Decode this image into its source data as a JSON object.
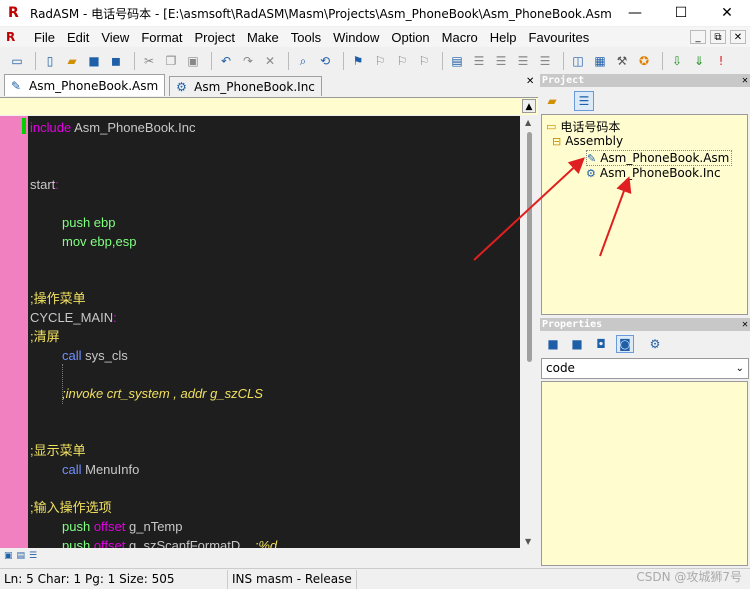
{
  "window": {
    "title": "RadASM - 电话号码本 - [E:\\asmsoft\\RadASM\\Masm\\Projects\\Asm_PhoneBook\\Asm_PhoneBook.Asm]",
    "minimize": "—",
    "maximize": "☐",
    "close": "✕"
  },
  "menu": {
    "items": [
      "File",
      "Edit",
      "View",
      "Format",
      "Project",
      "Make",
      "Tools",
      "Window",
      "Option",
      "Macro",
      "Help",
      "Favourites"
    ],
    "right_buttons": [
      "_",
      "⧉",
      "✕"
    ]
  },
  "toolbar": {
    "icons": [
      "print-icon",
      "new-file-icon",
      "open-icon",
      "save-icon",
      "save-all-icon",
      "cut-icon",
      "copy-icon",
      "paste-icon",
      "undo-icon",
      "redo-icon",
      "delete-icon",
      "find-icon",
      "replace-icon",
      "bookmark-icon",
      "next-bookmark-icon",
      "prev-bookmark-icon",
      "clear-bookmark-icon",
      "block-icon",
      "indent-icon",
      "outdent-icon",
      "comment-icon",
      "uncomment-icon",
      "view-output-icon",
      "view-project-icon",
      "tools-icon",
      "star-icon",
      "build-icon",
      "go-icon",
      "error-icon"
    ]
  },
  "tabs": [
    {
      "label": "Asm_PhoneBook.Asm",
      "active": true
    },
    {
      "label": "Asm_PhoneBook.Inc",
      "active": false
    }
  ],
  "editor": {
    "lines": [
      {
        "indent": 0,
        "parts": [
          {
            "t": "include ",
            "c": "kw"
          },
          {
            "t": "Asm_PhoneBook.Inc",
            "c": "lbl"
          }
        ]
      },
      {
        "indent": 0,
        "parts": []
      },
      {
        "indent": 0,
        "parts": []
      },
      {
        "indent": 0,
        "parts": [
          {
            "t": "start",
            "c": "lbl"
          },
          {
            "t": ":",
            "c": "kw"
          }
        ]
      },
      {
        "indent": 0,
        "parts": []
      },
      {
        "indent": 1,
        "parts": [
          {
            "t": "push ebp",
            "c": "ins"
          }
        ]
      },
      {
        "indent": 1,
        "parts": [
          {
            "t": "mov ebp,esp",
            "c": "ins"
          }
        ]
      },
      {
        "indent": 0,
        "parts": []
      },
      {
        "indent": 0,
        "parts": []
      },
      {
        "indent": 0,
        "parts": [
          {
            "t": ";操作菜单",
            "c": "cm"
          }
        ]
      },
      {
        "indent": 0,
        "parts": [
          {
            "t": "CYCLE_MAIN",
            "c": "lbl"
          },
          {
            "t": ":",
            "c": "kw"
          }
        ]
      },
      {
        "indent": 0,
        "parts": [
          {
            "t": ";清屏",
            "c": "cm"
          }
        ]
      },
      {
        "indent": 1,
        "parts": [
          {
            "t": "call ",
            "c": "call"
          },
          {
            "t": "sys_cls",
            "c": "lbl"
          }
        ]
      },
      {
        "indent": 0,
        "parts": []
      },
      {
        "indent": 1,
        "parts": [
          {
            "t": ";invoke crt_system , addr g_szCLS",
            "c": "cm-i"
          }
        ]
      },
      {
        "indent": 0,
        "parts": []
      },
      {
        "indent": 0,
        "parts": []
      },
      {
        "indent": 0,
        "parts": [
          {
            "t": ";显示菜单",
            "c": "cm"
          }
        ]
      },
      {
        "indent": 1,
        "parts": [
          {
            "t": "call ",
            "c": "call"
          },
          {
            "t": "MenuInfo",
            "c": "lbl"
          }
        ]
      },
      {
        "indent": 0,
        "parts": []
      },
      {
        "indent": 0,
        "parts": [
          {
            "t": ";输入操作选项",
            "c": "cm"
          }
        ]
      },
      {
        "indent": 1,
        "parts": [
          {
            "t": "push ",
            "c": "ins"
          },
          {
            "t": "offset ",
            "c": "kw"
          },
          {
            "t": "g_nTemp",
            "c": "lbl"
          }
        ]
      },
      {
        "indent": 1,
        "parts": [
          {
            "t": "push ",
            "c": "ins"
          },
          {
            "t": "offset ",
            "c": "kw"
          },
          {
            "t": "g_szScanfFormatD",
            "c": "lbl"
          },
          {
            "t": "    ;%d",
            "c": "cm-i"
          }
        ]
      }
    ]
  },
  "project_panel": {
    "title": "Project",
    "tree": [
      {
        "label": "电话号码本",
        "icon": "folder-open-icon"
      },
      {
        "label": "Assembly",
        "icon": "folder-icon"
      },
      {
        "label": "Asm_PhoneBook.Asm",
        "icon": "asm-file-icon"
      },
      {
        "label": "Asm_PhoneBook.Inc",
        "icon": "inc-file-icon"
      }
    ]
  },
  "properties_panel": {
    "title": "Properties",
    "selected": "code"
  },
  "bottom_strip": {
    "icons": [
      "output-icon",
      "immediate-icon",
      "debug-icon"
    ]
  },
  "status": {
    "position": "Ln: 5 Char: 1 Pg: 1 Size: 505",
    "mode": "INS masm - Release"
  },
  "watermark": "CSDN @攻城狮7号",
  "colors": {
    "editor_bg": "#1e1e1e",
    "gutter": "#f080c0",
    "panel_bg": "#fffdd0",
    "annotation_arrow": "#e02020"
  }
}
